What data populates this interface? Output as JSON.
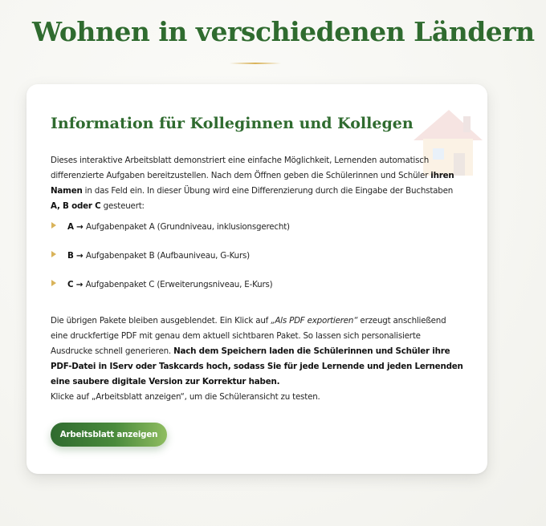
{
  "page": {
    "title": "Wohnen in verschiedenen Ländern"
  },
  "card": {
    "heading": "Information für Kolleginnen und Kollegen",
    "intro": {
      "t1": "Dieses interaktive Arbeitsblatt demonstriert eine einfache Möglichkeit, Lernenden automatisch differenzierte Aufgaben bereitzustellen. Nach dem Öffnen geben die Schülerinnen und Schüler ",
      "b1": "ihren Namen",
      "t2": " in das Feld ein. In dieser Übung wird eine Differenzierung durch die Eingabe der Buchstaben ",
      "b2": "A, B oder C",
      "t3": " gesteuert:"
    },
    "packages": [
      {
        "letter": "A",
        "arrow": " → ",
        "text": "Aufgabenpaket A (Grundniveau, inklusionsgerecht)"
      },
      {
        "letter": "B",
        "arrow": " → ",
        "text": "Aufgabenpaket B (Aufbauniveau, G-Kurs)"
      },
      {
        "letter": "C",
        "arrow": " → ",
        "text": "Aufgabenpaket C (Erweiterungsniveau, E-Kurs)"
      }
    ],
    "outro": {
      "t1": "Die übrigen Pakete bleiben ausgeblendet. Ein Klick auf ",
      "i1": "„Als PDF exportieren“",
      "t2": " erzeugt anschließend eine druckfertige PDF mit genau dem aktuell sichtbaren Paket. So lassen sich personalisierte Ausdrucke schnell generieren. ",
      "b1": "Nach dem Speichern laden die Schülerinnen und Schüler ihre PDF-Datei in IServ oder Taskcards hoch, sodass Sie für jede Lernende und jeden Lernenden eine saubere digitale Version zur Korrektur haben.",
      "t3": "Klicke auf „Arbeitsblatt anzeigen“, um die Schüleransicht zu testen."
    },
    "button_label": "Arbeitsblatt anzeigen"
  },
  "colors": {
    "title_green": "#2f6b2f",
    "accent_gold": "#d9b35a",
    "button_gradient_start": "#2f6b2f",
    "button_gradient_end": "#8fbd60"
  },
  "icons": {
    "decoration": "house-icon",
    "list_marker": "triangle-bullet-icon"
  }
}
